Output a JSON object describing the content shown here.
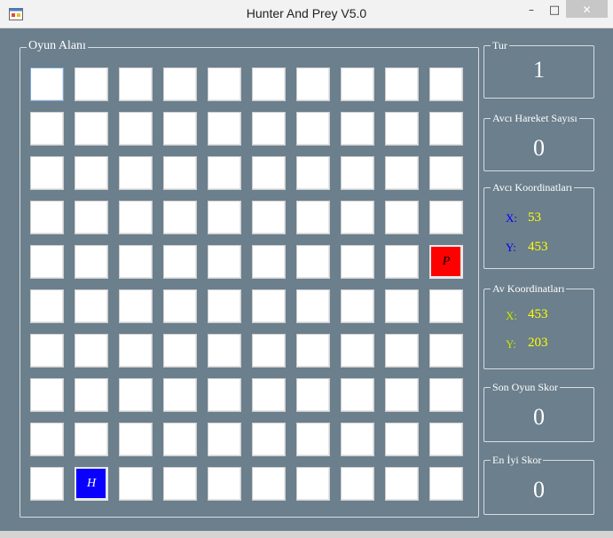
{
  "window": {
    "title": "Hunter And Prey V5.0",
    "minimize_glyph": "–",
    "maximize_glyph": "□",
    "close_glyph": "✕"
  },
  "board": {
    "label": "Oyun Alanı",
    "rows": 10,
    "cols": 10,
    "prey": {
      "row": 4,
      "col": 9,
      "text": "P"
    },
    "hunter": {
      "row": 9,
      "col": 1,
      "text": "H"
    }
  },
  "stats": {
    "tur": {
      "label": "Tur",
      "value": "1"
    },
    "hunter_moves": {
      "label": "Avcı Hareket Sayısı",
      "value": "0"
    },
    "hunter_coords": {
      "label": "Avcı Koordinatları",
      "x_label": "X:",
      "x": "53",
      "y_label": "Y:",
      "y": "453"
    },
    "prey_coords": {
      "label": "Av Koordinatları",
      "x_label": "X:",
      "x": "453",
      "y_label": "Y:",
      "y": "203"
    },
    "last_score": {
      "label": "Son Oyun Skor",
      "value": "0"
    },
    "best_score": {
      "label": "En İyi Skor",
      "value": "0"
    }
  },
  "colors": {
    "background": "#6b7f8c",
    "prey": "#ff0000",
    "hunter": "#0a00ff",
    "hunter_coord_label": "#0000ff",
    "prey_coord_label": "#c8e600",
    "coord_value": "#ffff00"
  }
}
